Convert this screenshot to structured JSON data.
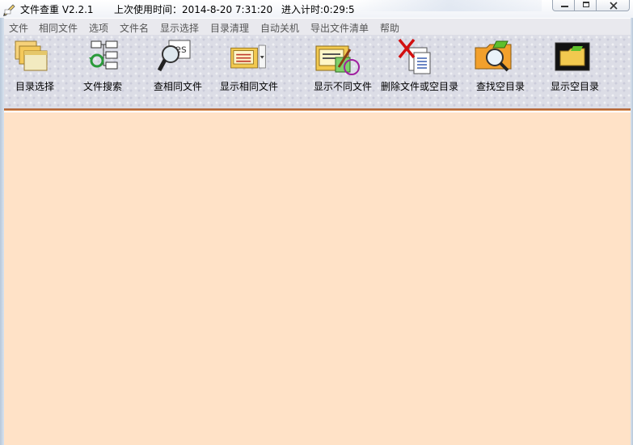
{
  "window": {
    "title": "文件查重 V2.2.1",
    "last_used": "上次使用时间：2014-8-20  7:31:20",
    "timer": "进入计时:0:29:5"
  },
  "menu": {
    "items": [
      "文件",
      "相同文件",
      "选项",
      "文件名",
      "显示选择",
      "目录清理",
      "自动关机",
      "导出文件清单",
      "帮助"
    ]
  },
  "toolbar": {
    "items": [
      {
        "label": "目录选择",
        "icon": "folder-stack-icon"
      },
      {
        "label": "文件搜索",
        "icon": "file-search-tree-icon"
      },
      {
        "label": "查相同文件",
        "icon": "magnifier-search-icon"
      },
      {
        "label": "显示相同文件",
        "icon": "folder-duplicate-icon"
      },
      {
        "label": "显示不同文件",
        "icon": "folder-different-icon"
      },
      {
        "label": "删除文件或空目录",
        "icon": "delete-file-icon"
      },
      {
        "label": "查找空目录",
        "icon": "find-empty-folder-icon"
      },
      {
        "label": "显示空目录",
        "icon": "empty-folder-icon"
      }
    ]
  },
  "colors": {
    "content_bg": "#ffe2c7",
    "separator": "#b5683a",
    "menu_text": "#555555"
  }
}
